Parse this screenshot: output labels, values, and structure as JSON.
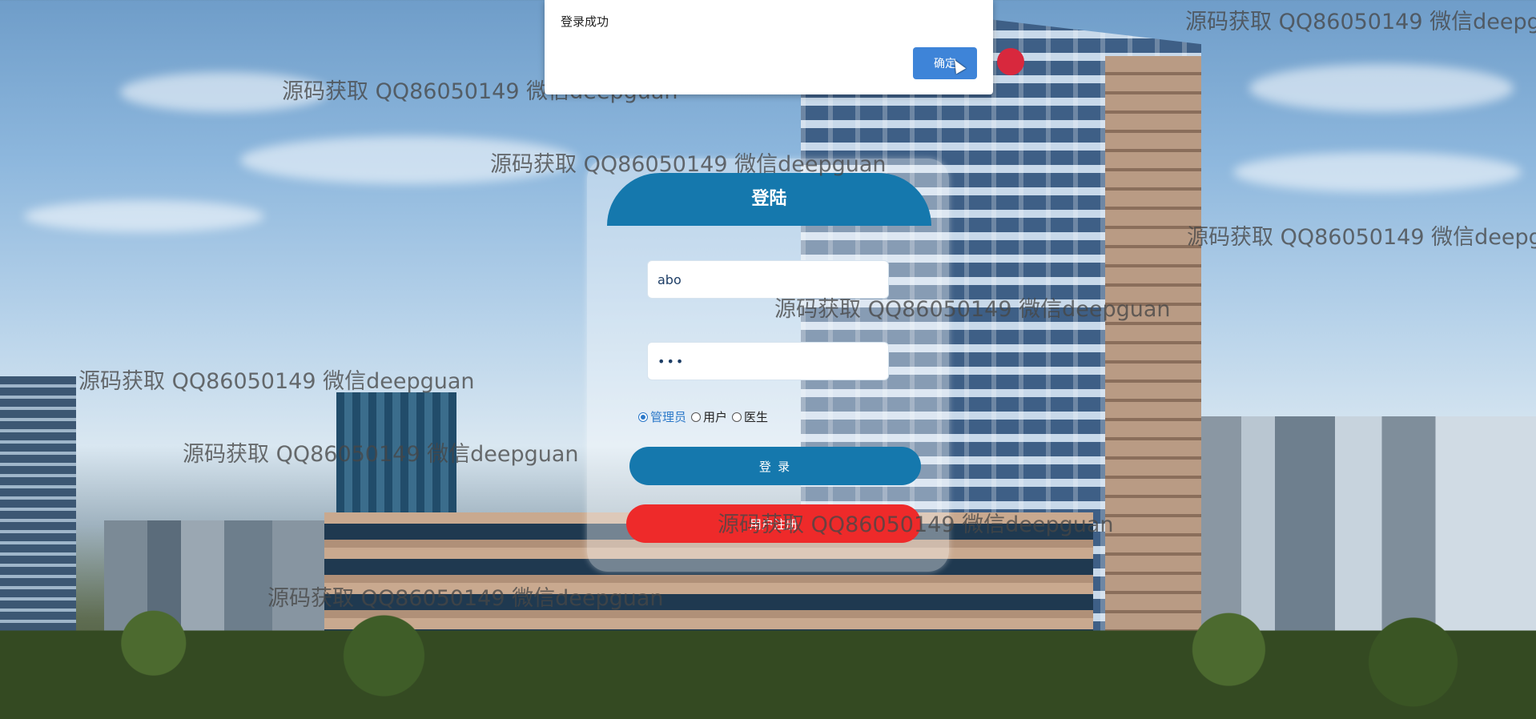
{
  "dialog": {
    "message": "登录成功",
    "ok_label": "确定"
  },
  "login": {
    "title": "登陆",
    "username_value": "abo",
    "password_value": "•••",
    "roles": [
      {
        "label": "管理员",
        "selected": true
      },
      {
        "label": "用户",
        "selected": false
      },
      {
        "label": "医生",
        "selected": false
      }
    ],
    "login_label": "登 录",
    "register_label": "用户注册"
  },
  "watermark_text": "源码获取 QQ86050149 微信deepguan",
  "colors": {
    "primary": "#1578ad",
    "danger": "#ee2a2a",
    "dialog_button": "#3e84d8"
  }
}
